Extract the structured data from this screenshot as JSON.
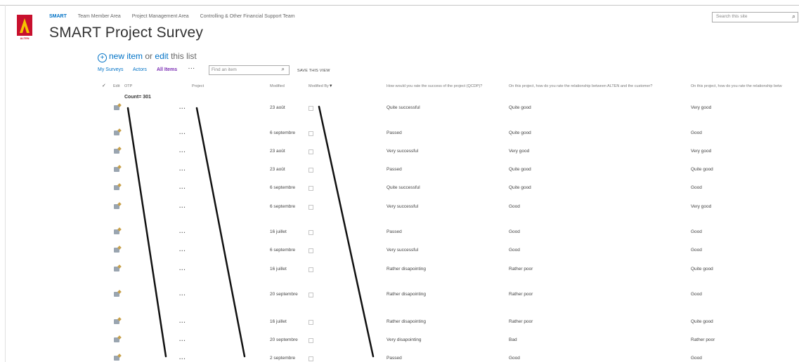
{
  "top_nav": {
    "items": [
      "SMART",
      "Team Member Area",
      "Project Management Area",
      "Controlling & Other Financial Support Team"
    ]
  },
  "logo": {
    "text": "ALTEN",
    "colors": {
      "red": "#c8102e",
      "yellow": "#f5c400"
    }
  },
  "search": {
    "placeholder": "Search this site",
    "icon": "search-icon"
  },
  "page_title": "SMART Project Survey",
  "new_item": {
    "new_label": "new item",
    "or": "or",
    "edit_label": "edit",
    "rest": "this list"
  },
  "views": {
    "items": [
      "My Surveys",
      "Actors",
      "All Items"
    ],
    "more": "···"
  },
  "find_item": {
    "placeholder": "Find an item",
    "icon": "search-icon"
  },
  "save_view": "SAVE THIS VIEW",
  "columns": {
    "check": "✓",
    "edit": "Edit",
    "otp": "OTP",
    "project": "Project",
    "modified": "Modified",
    "modified_by": "Modified By",
    "q1": "How would you rate the success of the project (QCDP)?",
    "q2": "On this project, how do you rate the relationship between ALTEN and the customer?",
    "q3": "On this project, how do you rate the relationship betw"
  },
  "count_label": "Count= 301",
  "rows": [
    {
      "modified": "23 août",
      "q1": "Quite successful",
      "q2": "Quite good",
      "q3": "Very good"
    },
    {
      "modified": "6 septembre",
      "q1": "Passed",
      "q2": "Quite good",
      "q3": "Good"
    },
    {
      "modified": "23 août",
      "q1": "Very successful",
      "q2": "Very good",
      "q3": "Very good"
    },
    {
      "modified": "23 août",
      "q1": "Passed",
      "q2": "Quite good",
      "q3": "Quite good"
    },
    {
      "modified": "6 septembre",
      "q1": "Quite successful",
      "q2": "Quite good",
      "q3": "Good"
    },
    {
      "modified": "6 septembre",
      "q1": "Very successful",
      "q2": "Good",
      "q3": "Very good"
    },
    {
      "modified": "16 juillet",
      "q1": "Passed",
      "q2": "Good",
      "q3": "Good"
    },
    {
      "modified": "6 septembre",
      "q1": "Very successful",
      "q2": "Good",
      "q3": "Good"
    },
    {
      "modified": "16 juillet",
      "q1": "Rather disapointing",
      "q2": "Rather poor",
      "q3": "Quite good"
    },
    {
      "modified": "20 septembre",
      "q1": "Rather disapointing",
      "q2": "Rather poor",
      "q3": "Good"
    },
    {
      "modified": "16 juillet",
      "q1": "Rather disapointing",
      "q2": "Rather poor",
      "q3": "Quite good"
    },
    {
      "modified": "20 septembre",
      "q1": "Very disapointing",
      "q2": "Bad",
      "q3": "Rather poor"
    },
    {
      "modified": "2 septembre",
      "q1": "Passed",
      "q2": "Good",
      "q3": "Good"
    }
  ],
  "colors": {
    "accent": "#0072c6",
    "selected_view": "#7a2cb3"
  }
}
